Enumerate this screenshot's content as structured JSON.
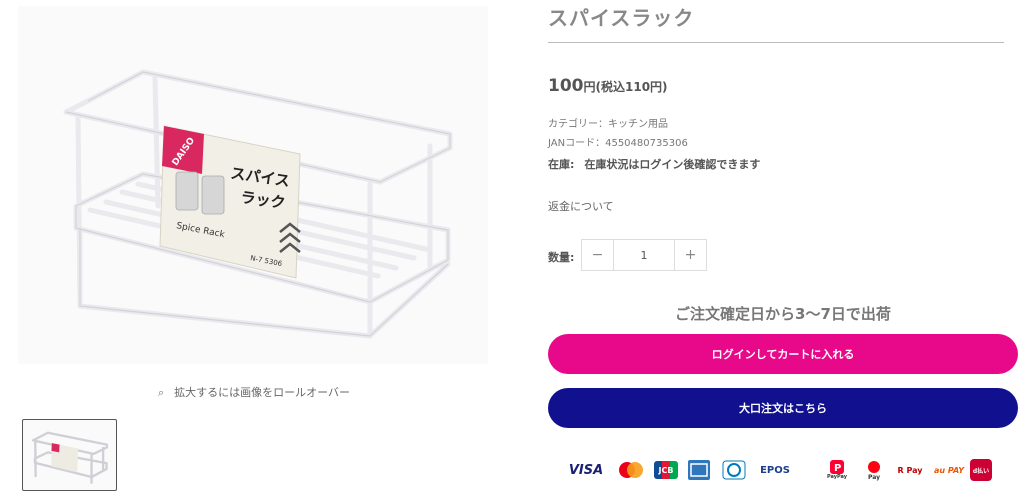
{
  "product": {
    "title": "スパイスラック",
    "price_amount": "100",
    "price_unit": "円",
    "price_tax": "(税込110円)",
    "category": "カテゴリー：キッチン用品",
    "jan": "JANコード：4550480735306",
    "stock_label": "在庫:",
    "stock_status": "在庫状況はログイン後確認できます",
    "refund_link": "返金について"
  },
  "gallery": {
    "zoom_hint": "拡大するには画像をロールオーバー",
    "package_brand": "DAISO",
    "package_title_1": "スパイス",
    "package_title_2": "ラック",
    "package_en": "Spice Rack",
    "package_code": "N-7 5306"
  },
  "quantity": {
    "label": "数量:",
    "minus": "−",
    "value": "1",
    "plus": "+"
  },
  "shipping_note": "ご注文確定日から3〜7日で出荷",
  "buttons": {
    "login_cart": "ログインしてカートに入れる",
    "bulk_order": "大口注文はこちら"
  },
  "payments": [
    {
      "name": "visa",
      "label": "VISA"
    },
    {
      "name": "mastercard",
      "label": ""
    },
    {
      "name": "jcb",
      "label": "JCB"
    },
    {
      "name": "amex",
      "label": ""
    },
    {
      "name": "diners",
      "label": ""
    },
    {
      "name": "epos",
      "label": "EPOS"
    },
    {
      "name": "paypay",
      "label": "PayPay"
    },
    {
      "name": "merpay",
      "label": "Pay"
    },
    {
      "name": "rakuten-pay",
      "label": "R Pay"
    },
    {
      "name": "au-pay",
      "label": "au PAY"
    },
    {
      "name": "d-barai",
      "label": "d払い"
    }
  ],
  "colors": {
    "login_button": "#e8088a",
    "bulk_button": "#11118f",
    "title_text": "#888888"
  }
}
